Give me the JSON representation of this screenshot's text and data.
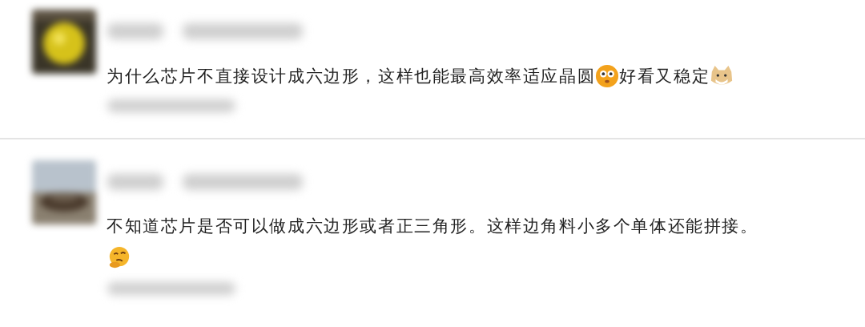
{
  "comments": [
    {
      "avatar": {
        "kind": "picture"
      },
      "content": [
        {
          "kind": "text",
          "text": "为什么芯片不直接设计成六边形，这样也能最高效率适应晶圆"
        },
        {
          "kind": "smiley"
        },
        {
          "kind": "text",
          "text": "好看又稳定"
        },
        {
          "kind": "cat"
        }
      ]
    },
    {
      "avatar": {
        "kind": "picture"
      },
      "content": [
        {
          "kind": "text",
          "text": "不知道芯片是否可以做成六边形或者正三角形。这样边角料小多个单体还能拼接。"
        }
      ],
      "trailing": [
        {
          "kind": "thinking"
        }
      ]
    }
  ]
}
